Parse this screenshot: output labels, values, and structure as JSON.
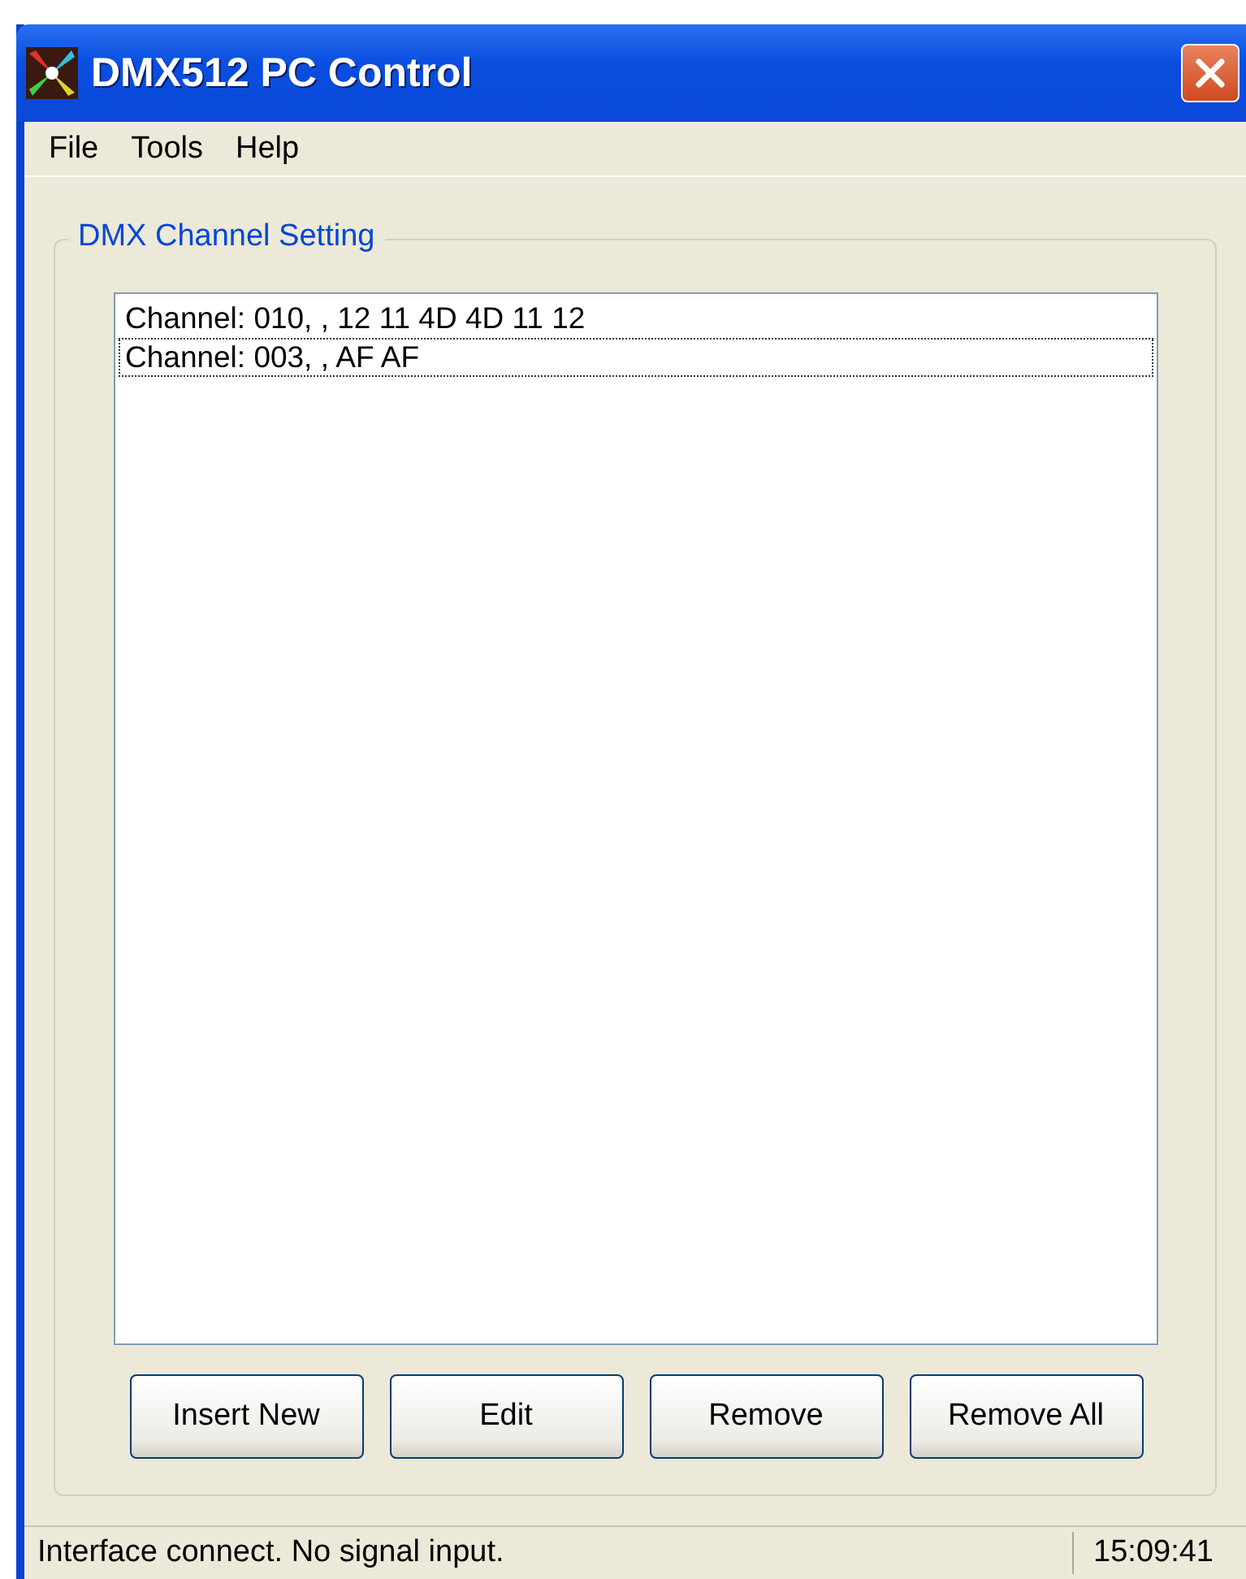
{
  "window": {
    "title": "DMX512 PC Control"
  },
  "menu": [
    "File",
    "Tools",
    "Help"
  ],
  "group": {
    "title": "DMX Channel Setting"
  },
  "list_items": [
    {
      "text": "Channel: 010, , 12 11 4D 4D 11 12",
      "focused": false
    },
    {
      "text": "Channel: 003, , AF AF",
      "focused": true
    }
  ],
  "buttons": [
    "Insert New",
    "Edit",
    "Remove",
    "Remove All"
  ],
  "status_bar": {
    "message": "Interface connect. No signal input.",
    "time": "15:09:41"
  }
}
